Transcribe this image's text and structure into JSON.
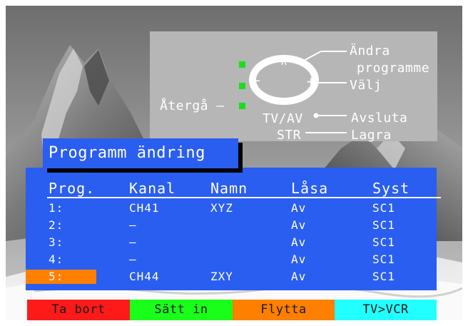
{
  "help": {
    "change_label_line1": "Ändra",
    "change_label_line2": "programme",
    "select_label": "Välj",
    "back_label": "Återgå –",
    "tvav_label": "TV/AV",
    "exit_label": "Avsluta",
    "str_label": "STR",
    "save_label": "Lagra",
    "up_symbol": "∧",
    "down_symbol": "∨",
    "minus_symbol": "−",
    "plus_symbol": "+"
  },
  "title": "Programm ändring",
  "table": {
    "headers": [
      "Prog.",
      "Kanal",
      "Namn",
      "Låsa",
      "Syst"
    ],
    "rows": [
      [
        "1:",
        "CH41",
        "XYZ",
        "Av",
        "SC1"
      ],
      [
        "2:",
        "–",
        "",
        "Av",
        "SC1"
      ],
      [
        "3:",
        "–",
        "",
        "Av",
        "SC1"
      ],
      [
        "4:",
        "–",
        "",
        "Av",
        "SC1"
      ],
      [
        "5:",
        "CH44",
        "ZXY",
        "Av",
        "SC1"
      ]
    ],
    "selected_row": 5
  },
  "buttons": [
    {
      "label": "Ta bort",
      "color": "#ff1a1a"
    },
    {
      "label": "Sätt in",
      "color": "#1aff1a"
    },
    {
      "label": "Flytta",
      "color": "#ff7f00"
    },
    {
      "label": "TV>VCR",
      "color": "#22ffff"
    }
  ],
  "colors": {
    "panel_blue": "#2a5ef0",
    "highlight": "#ff7f00",
    "indicator_green": "#18e018"
  }
}
